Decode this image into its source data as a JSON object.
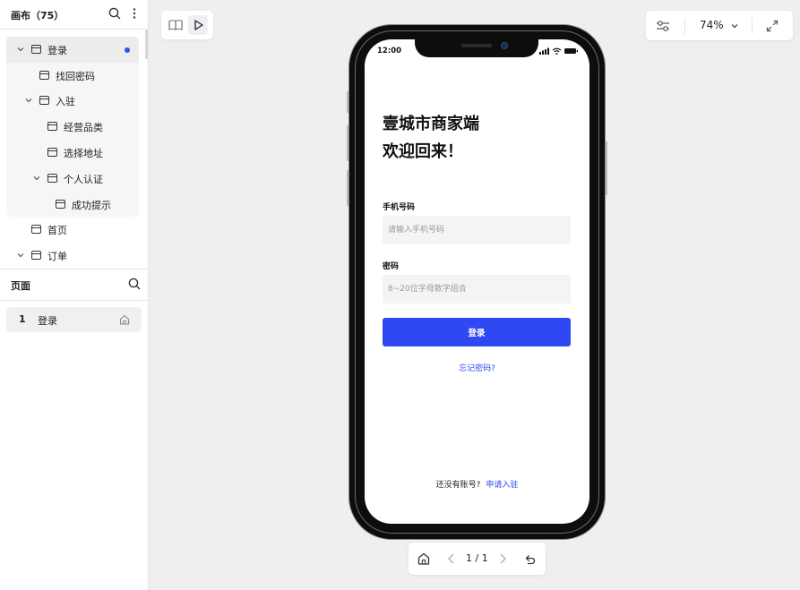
{
  "sidebar": {
    "canvas_title": "画布（75）",
    "tree": [
      {
        "label": "登录",
        "has_chevron": true,
        "selected": true,
        "indicator_dot": true
      },
      {
        "label": "找回密码",
        "has_chevron": false
      },
      {
        "label": "入驻",
        "has_chevron": true
      },
      {
        "label": "经营品类",
        "has_chevron": false
      },
      {
        "label": "选择地址",
        "has_chevron": false
      },
      {
        "label": "个人认证",
        "has_chevron": true
      },
      {
        "label": "成功提示",
        "has_chevron": false
      },
      {
        "label": "首页",
        "has_chevron": false
      },
      {
        "label": "订单",
        "has_chevron": true
      }
    ],
    "pages_title": "页面",
    "pages": [
      {
        "number": "1",
        "name": "登录",
        "icon": "home-icon"
      }
    ]
  },
  "toolbar": {
    "left_icons": [
      "book-icon",
      "play-icon"
    ],
    "right_icons": [
      "adjustments-icon",
      "chevron-down-icon",
      "fullscreen-icon"
    ],
    "zoom": "74%"
  },
  "nav": {
    "page_indicator": "1 / 1",
    "icons": [
      "home-icon",
      "prev-icon",
      "next-icon",
      "undo-icon"
    ]
  },
  "phone": {
    "status_time": "12:00",
    "title_line1": "壹城市商家端",
    "title_line2": "欢迎回来！",
    "phone_label": "手机号码",
    "phone_placeholder": "请输入手机号码",
    "password_label": "密码",
    "password_placeholder": "8~20位字母数字组合",
    "login_button": "登录",
    "forgot_link": "忘记密码?",
    "signup_prompt": "还没有账号?",
    "signup_link": "申请入驻"
  },
  "colors": {
    "accent": "#2f48f3",
    "canvas_bg": "#efefef",
    "selection_dot": "#2f54eb"
  }
}
